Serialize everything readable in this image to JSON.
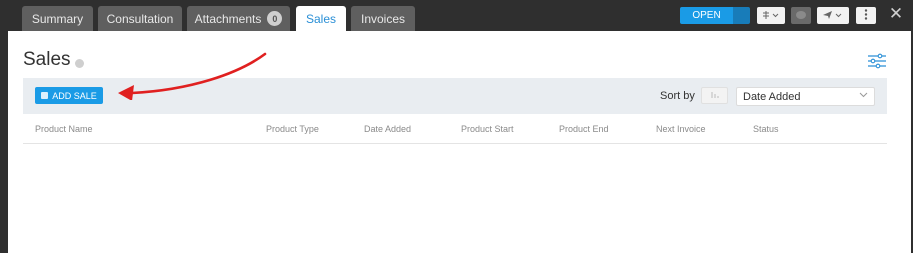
{
  "tabs": [
    {
      "label": "Summary"
    },
    {
      "label": "Consultation"
    },
    {
      "label": "Attachments",
      "badge": "0"
    },
    {
      "label": "Sales",
      "active": true
    },
    {
      "label": "Invoices"
    }
  ],
  "header": {
    "status_button": "OPEN",
    "tool_icons": [
      "list-dropdown-icon",
      "chat-icon",
      "send-dropdown-icon",
      "more-icon"
    ],
    "close_glyph": "✕"
  },
  "page": {
    "title": "Sales"
  },
  "toolbar": {
    "add_button": "ADD SALE",
    "sort_label": "Sort by",
    "sort_value": "Date Added"
  },
  "table": {
    "columns": [
      "Product Name",
      "Product Type",
      "Date Added",
      "Product Start",
      "Product End",
      "Next Invoice",
      "Status"
    ]
  },
  "colors": {
    "accent": "#1a9be6",
    "annotation_arrow": "#e02020"
  }
}
